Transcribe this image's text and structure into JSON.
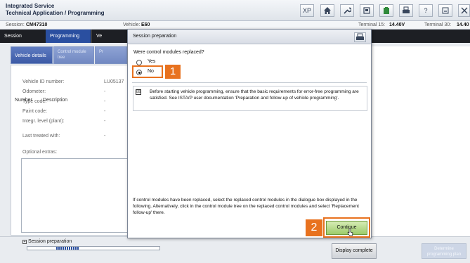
{
  "window": {
    "title_line1": "Integrated Service",
    "title_line2": "Technical Application / Programming",
    "toolbar_icons": [
      "xp-icon",
      "home-icon",
      "wrench-icon",
      "vci-icon",
      "battery-icon",
      "print-icon",
      "help-icon",
      "minimize-icon",
      "close-icon"
    ],
    "xp_label": "XP",
    "help_label": "?"
  },
  "session_row": {
    "session_label": "Session:",
    "session_value": "CM47310",
    "vehicle_label": "Vehicle:",
    "vehicle_value": "E60",
    "terminal15_label": "Terminal 15:",
    "terminal15_value": "14.40V",
    "terminal30_label": "Terminal 30:",
    "terminal30_value": "14.40"
  },
  "nav": {
    "items": [
      {
        "label": "Session"
      },
      {
        "label": "Programming"
      },
      {
        "label": "Ve"
      }
    ]
  },
  "subtabs": [
    {
      "label": "Vehicle details"
    },
    {
      "label": "Control module tree"
    },
    {
      "label": "Pr"
    }
  ],
  "vehicle_details": {
    "rows": [
      {
        "label": "Vehicle ID number:",
        "value": "LU05137"
      },
      {
        "label": "Odometer:",
        "value": "-"
      },
      {
        "label": "Type code:",
        "value": "-"
      },
      {
        "label": "Paint code:",
        "value": "-"
      },
      {
        "label": "Integr. level (plant):",
        "value": "-"
      },
      {
        "label": "Last treated with:",
        "value": "-"
      }
    ],
    "optional_extras_label": "Optional extras:",
    "table_headers": {
      "number": "Number",
      "description": "Description"
    }
  },
  "bottom": {
    "session_preparation_label": "Session preparation",
    "progress_fraction": 0.17,
    "display_complete_label": "Display complete",
    "determine_label": "Determine programming plan"
  },
  "dialog": {
    "title": "Session preparation",
    "question": "Were control modules replaced?",
    "options": [
      {
        "label": "Yes",
        "checked": false
      },
      {
        "label": "No",
        "checked": true
      }
    ],
    "annotation_1": "1",
    "annotation_2": "2",
    "notice_checked": true,
    "notice_mark": "☒",
    "notice_text": "Before starting vehicle programming, ensure that the basic requirements for error-free programming are satisfied. See ISTA/P user documentation 'Preparation and follow-up of vehicle programming'.",
    "info_text": "If control modules have been replaced, select the replaced control modules in the dialogue box displayed in the following. Alternatively, click in the control module tree on the replaced control modules and select 'Replacement follow-up' there.",
    "continue_label": "Continue"
  },
  "colors": {
    "accent_orange": "#e8721f",
    "nav_dark": "#1d1f24",
    "nav_active": "#2a4fa0",
    "continue_green": "#9ccb6a"
  }
}
